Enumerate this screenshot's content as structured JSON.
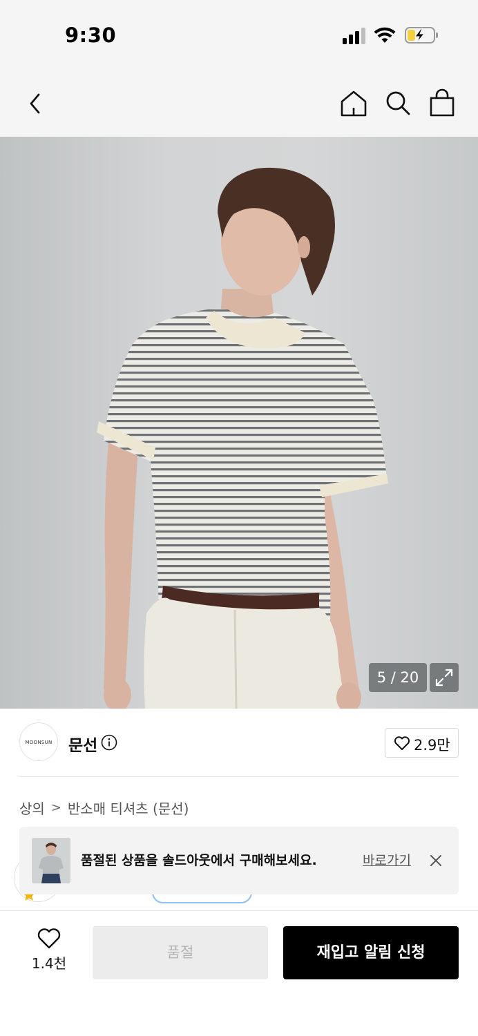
{
  "status_bar": {
    "time": "9:30"
  },
  "nav": {
    "icons": [
      "back-chevron-icon",
      "home-icon",
      "search-icon",
      "shopping-bag-icon"
    ]
  },
  "product_image": {
    "counter": "5 / 20",
    "expand_icon": "expand-icon"
  },
  "brand": {
    "logo_text": "MOONSUN",
    "name": "문선",
    "like_count": "2.9만"
  },
  "breadcrumb": {
    "items": [
      "상의",
      "반소매 티셔츠 (문선)"
    ],
    "separator": ">"
  },
  "soldout_banner": {
    "message": "품절된 상품을 솔드아웃에서 구매해보세요.",
    "link_label": "바로가기",
    "close_icon": "close-icon"
  },
  "bottom_bar": {
    "wish_count": "1.4천",
    "soldout_label": "품절",
    "restock_label": "재입고 알림 신청"
  },
  "colors": {
    "primary_button": "#000000",
    "disabled_button": "#ececec",
    "banner_bg": "#f3f3f3",
    "battery_charge": "#f4d03f"
  }
}
